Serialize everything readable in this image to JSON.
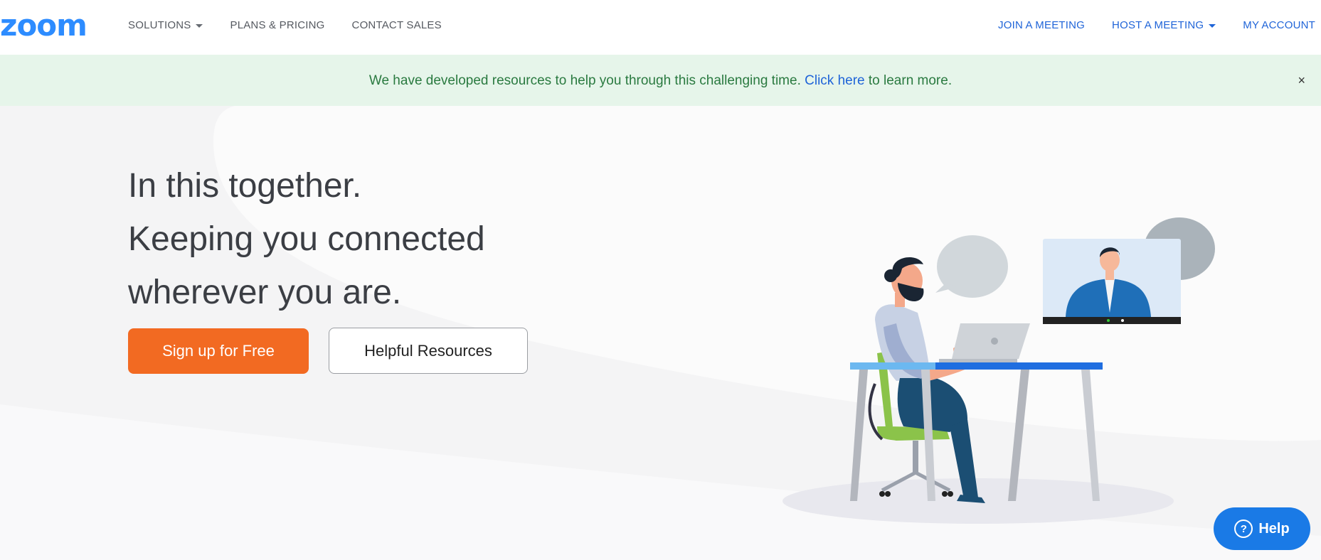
{
  "brand": {
    "logo_text": "zoom",
    "accent": "#1f64d8",
    "cta_color": "#f26a22"
  },
  "nav": {
    "left": [
      {
        "label": "SOLUTIONS",
        "has_dropdown": true
      },
      {
        "label": "PLANS & PRICING"
      },
      {
        "label": "CONTACT SALES"
      }
    ],
    "right": [
      {
        "label": "JOIN A MEETING"
      },
      {
        "label": "HOST A MEETING",
        "has_dropdown": true
      },
      {
        "label": "MY ACCOUNT"
      }
    ]
  },
  "banner": {
    "text_before": "We have developed resources to help you through this challenging time. ",
    "link": "Click here",
    "text_after": " to learn more.",
    "close": "×"
  },
  "hero": {
    "lines": [
      "In this together.",
      "Keeping you connected",
      "wherever you are."
    ],
    "primary_button": "Sign up for Free",
    "secondary_button": "Helpful Resources"
  },
  "help": {
    "icon": "?",
    "label": "Help"
  }
}
